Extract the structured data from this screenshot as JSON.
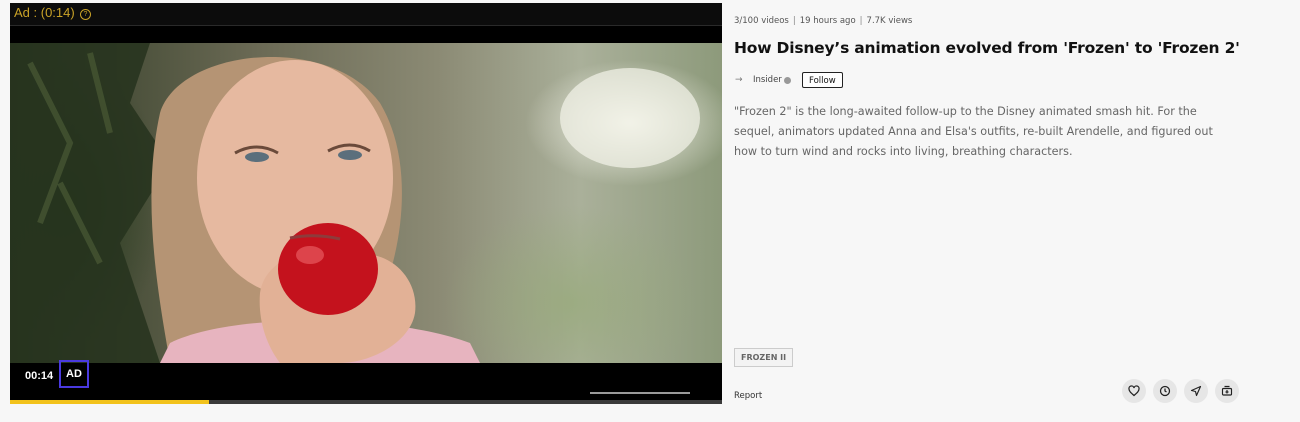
{
  "player": {
    "ad_countdown": "Ad : (0:14)",
    "ad_info_icon": "?",
    "current_time": "00:14",
    "ad_badge": "AD",
    "progress": 0.28
  },
  "video": {
    "meta": {
      "position": "3/100 videos",
      "posted": "19 hours ago",
      "views": "7.7K views",
      "separator": "|"
    },
    "title": "How Disney’s animation evolved from 'Frozen' to 'Frozen 2'",
    "channel": {
      "name": "Insider",
      "arrow": "→",
      "follow_label": "Follow"
    },
    "description": "\"Frozen 2\" is the long-awaited follow-up to the Disney animated smash hit. For the sequel, animators updated Anna and Elsa's outfits, re-built Arendelle, and figured out how to turn wind and rocks into living, breathing characters.",
    "tag": "FROZEN II",
    "report_label": "Report",
    "actions": [
      "heart-icon",
      "clock-icon",
      "send-icon",
      "queue-icon"
    ]
  },
  "colors": {
    "accent_progress": "#f2c21b",
    "ad_text": "#c9a227",
    "ad_badge_border": "#4a3ae0"
  }
}
